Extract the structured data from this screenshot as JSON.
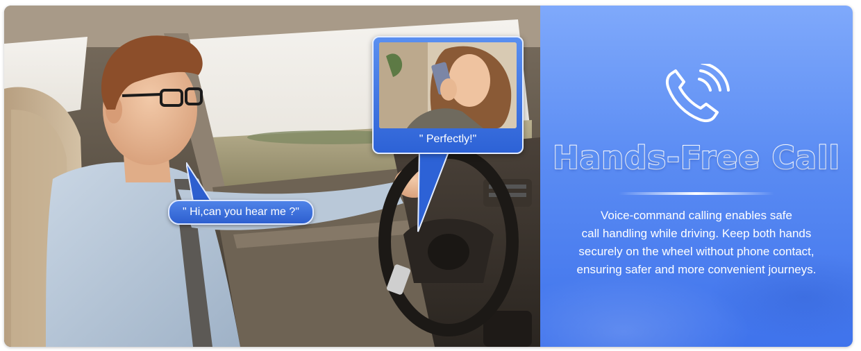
{
  "driver_bubble": {
    "text": "\" Hi,can you hear me ?\""
  },
  "caller_card": {
    "text": "\" Perfectly!\""
  },
  "panel": {
    "title": "Hands-Free Call",
    "description_lines": [
      "Voice-command calling enables safe",
      "call handling while driving. Keep both hands",
      "securely on the wheel without phone contact,",
      "ensuring safer and more convenient journeys."
    ]
  },
  "colors": {
    "panel_top": "#7fa9fb",
    "panel_bottom": "#3f73ec",
    "bubble_blue": "#2d5fcf",
    "text_white": "#ffffff"
  },
  "icons": {
    "panel_icon": "phone-call-icon"
  }
}
